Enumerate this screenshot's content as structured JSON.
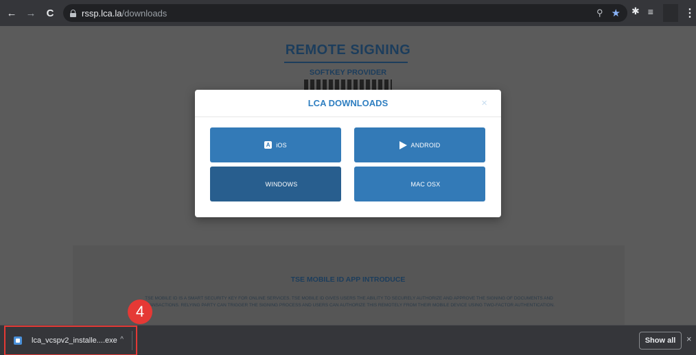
{
  "browser": {
    "url_host": "rssp.lca.la",
    "url_path": "/downloads",
    "back_icon": "←",
    "forward_icon": "→",
    "reload_icon": "C",
    "zoom_icon": "⚲",
    "star_icon": "★",
    "extensions_icon": "✱",
    "reading_list_icon": "≡",
    "menu_icon": "⋮"
  },
  "page": {
    "title": "REMOTE SIGNING",
    "subtitle": "SOFTKEY PROVIDER",
    "intro_title": "TSE MOBILE ID APP INTRODUCE",
    "intro_text": "TSE MOBILE ID IS A SMART SECURITY KEY FOR ONLINE SERVICES. TSE MOBILE ID GIVES USERS THE ABILITY TO SECURELY AUTHORIZE AND APPROVE THE SIGNING OF DOCUMENTS AND TRANSACTIONS. RELYING PARTY CAN TRIGGER THE SIGNING PROCESS AND USERS CAN AUTHORIZE THIS REMOTELY FROM THEIR MOBILE DEVICE USING TWO-FACTOR AUTHENTICATION."
  },
  "modal": {
    "title": "LCA DOWNLOADS",
    "close": "×",
    "buttons": {
      "ios": "iOS",
      "android": "ANDROID",
      "windows": "WINDOWS",
      "macosx": "MAC OSX"
    }
  },
  "downloads": {
    "file_name": "lca_vcspv2_installe....exe",
    "caret": "^",
    "show_all": "Show all",
    "close": "×",
    "step_number": "4"
  },
  "colors": {
    "accent": "#337ab7",
    "accent_active": "#285e8e",
    "highlight": "#e53935"
  }
}
